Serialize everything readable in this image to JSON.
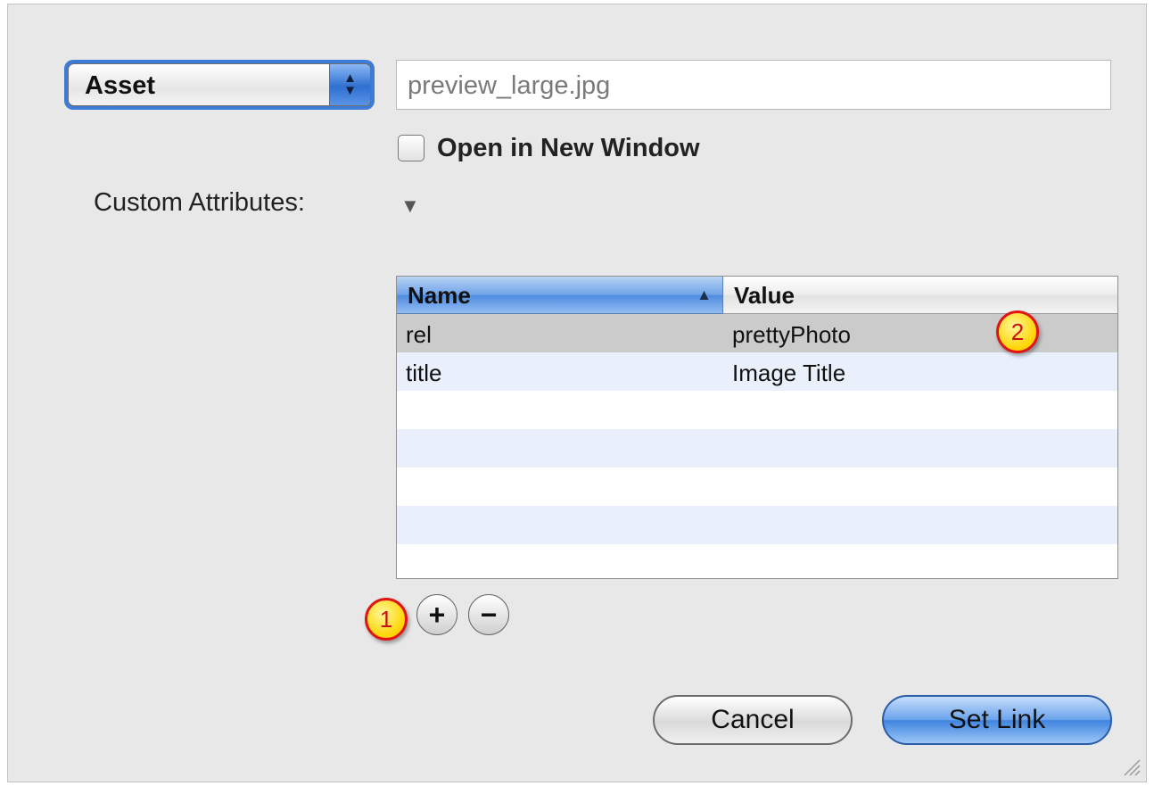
{
  "link_type": {
    "selected": "Asset"
  },
  "asset_field": {
    "value": "preview_large.jpg"
  },
  "open_new_window": {
    "label": "Open in New Window",
    "checked": false
  },
  "custom_attributes": {
    "label": "Custom Attributes:",
    "expanded": true,
    "columns": {
      "name": "Name",
      "value": "Value",
      "sort_column": "Name",
      "sort_direction": "ascending"
    },
    "rows": [
      {
        "name": "rel",
        "value": "prettyPhoto",
        "selected": true
      },
      {
        "name": "title",
        "value": "Image Title",
        "selected": false
      }
    ],
    "add_symbol": "+",
    "remove_symbol": "−"
  },
  "callouts": {
    "one": "1",
    "two": "2"
  },
  "buttons": {
    "cancel": "Cancel",
    "set_link": "Set Link"
  },
  "colors": {
    "accent": "#3d7bd6",
    "selected_row": "#cbcbcb",
    "alt_row": "#e9f0fc",
    "callout_fill": "#ffd400",
    "callout_border": "#e01414"
  },
  "icons": {
    "popup_arrows": "up-down-arrows-icon",
    "disclosure": "disclosure-triangle-icon",
    "sort": "sort-ascending-icon",
    "resize": "resize-grip-icon"
  }
}
